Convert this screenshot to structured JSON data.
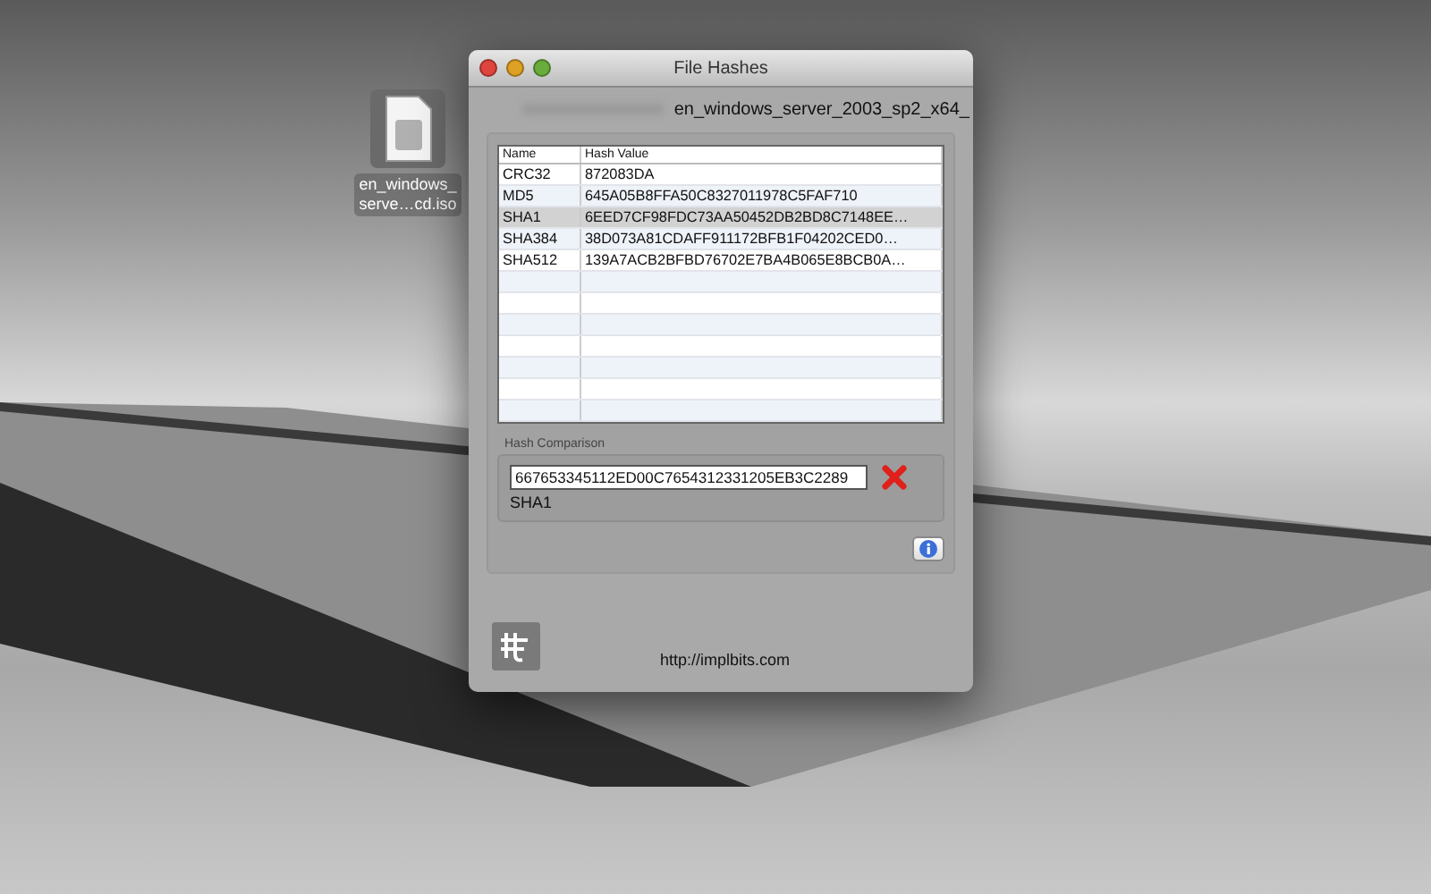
{
  "desktop": {
    "icon_label_lines": [
      "en_windows_",
      "serve…cd.iso"
    ]
  },
  "window": {
    "title": "File Hashes",
    "file_name": "en_windows_server_2003_sp2_x64_",
    "table": {
      "columns": [
        "Name",
        "Hash Value"
      ],
      "rows": [
        {
          "name": "CRC32",
          "hash": "872083DA",
          "selected": false
        },
        {
          "name": "MD5",
          "hash": "645A05B8FFA50C8327011978C5FAF710",
          "selected": false
        },
        {
          "name": "SHA1",
          "hash": "6EED7CF98FDC73AA50452DB2BD8C7148EE…",
          "selected": true
        },
        {
          "name": "SHA384",
          "hash": "38D073A81CDAFF911172BFB1F04202CED0…",
          "selected": false
        },
        {
          "name": "SHA512",
          "hash": "139A7ACB2BFBD76702E7BA4B065E8BCB0A…",
          "selected": false
        }
      ]
    },
    "comparison": {
      "label": "Hash Comparison",
      "value": "667653345112ED00C7654312331205EB3C2289",
      "algorithm": "SHA1",
      "match": false
    },
    "footer": {
      "link": "http://implbits.com"
    }
  }
}
